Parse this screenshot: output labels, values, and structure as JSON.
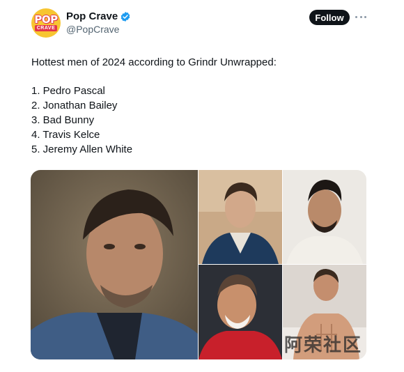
{
  "post": {
    "author": {
      "display_name": "Pop Crave",
      "handle": "@PopCrave",
      "avatar_text_top": "POP",
      "avatar_text_bottom": "CRAVE",
      "verified": true
    },
    "follow_label": "Follow",
    "more_icon": "ellipsis-icon",
    "text": {
      "intro": "Hottest men of 2024 according to Grindr Unwrapped:",
      "list": [
        "1. Pedro Pascal",
        "2. Jonathan Bailey",
        "3. Bad Bunny",
        "4. Travis Kelce",
        "5. Jeremy Allen White"
      ]
    },
    "media_count": 5
  },
  "watermark": "阿荣社区",
  "colors": {
    "follow_bg": "#0f1419",
    "verified": "#1d9bf0",
    "handle": "#536471",
    "avatar_bg": "#f7c531",
    "avatar_accent": "#e2344a"
  }
}
